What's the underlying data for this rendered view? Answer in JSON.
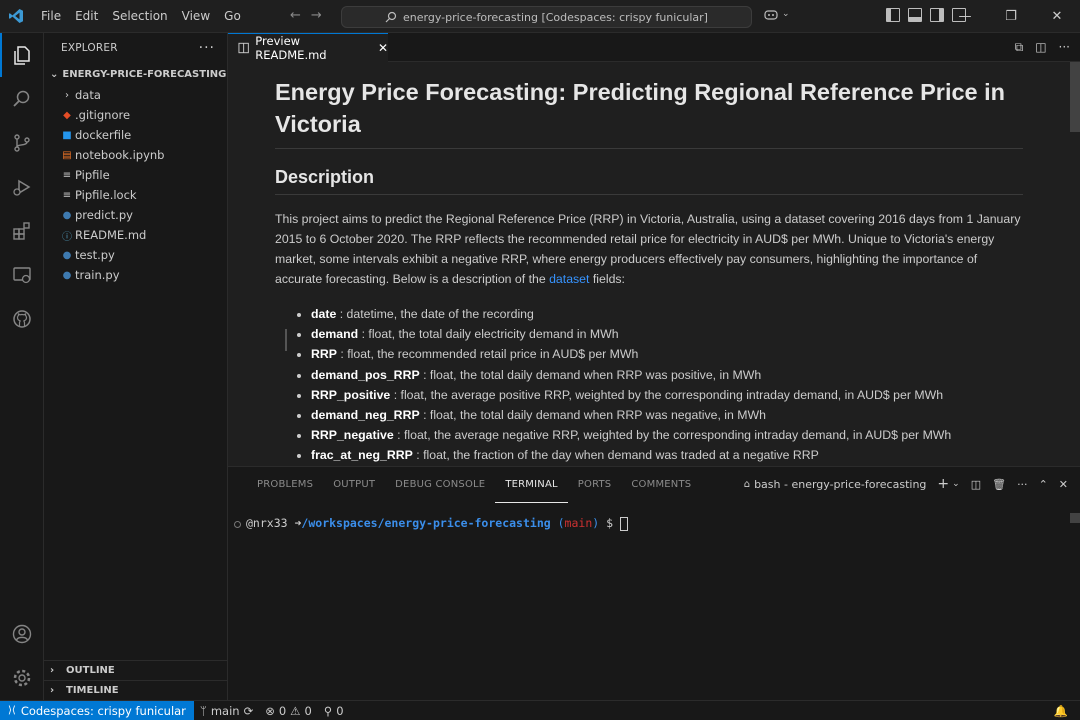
{
  "titlebar": {
    "menu": [
      "File",
      "Edit",
      "Selection",
      "View",
      "Go"
    ],
    "command_center": "energy-price-forecasting [Codespaces: crispy funicular]"
  },
  "activity_icons": [
    "explorer-icon",
    "search-icon",
    "source-control-icon",
    "run-debug-icon",
    "extensions-icon",
    "remote-explorer-icon",
    "github-icon",
    "account-icon",
    "settings-gear-icon"
  ],
  "sidebar": {
    "title": "EXPLORER",
    "root": "ENERGY-PRICE-FORECASTING [C...",
    "items": [
      {
        "label": "data",
        "kind": "folder"
      },
      {
        "label": ".gitignore",
        "kind": "gitignore"
      },
      {
        "label": "dockerfile",
        "kind": "docker"
      },
      {
        "label": "notebook.ipynb",
        "kind": "notebook"
      },
      {
        "label": "Pipfile",
        "kind": "text"
      },
      {
        "label": "Pipfile.lock",
        "kind": "text"
      },
      {
        "label": "predict.py",
        "kind": "python"
      },
      {
        "label": "README.md",
        "kind": "markdown"
      },
      {
        "label": "test.py",
        "kind": "python"
      },
      {
        "label": "train.py",
        "kind": "python"
      }
    ],
    "outline": "OUTLINE",
    "timeline": "TIMELINE"
  },
  "editor": {
    "tab_label": "Preview README.md",
    "h1": "Energy Price Forecasting: Predicting Regional Reference Price in Victoria",
    "h2": "Description",
    "para_before_link": "This project aims to predict the Regional Reference Price (RRP) in Victoria, Australia, using a dataset covering 2016 days from 1 January 2015 to 6 October 2020. The RRP reflects the recommended retail price for electricity in AUD$ per MWh. Unique to Victoria's energy market, some intervals exhibit a negative RRP, where energy producers effectively pay consumers, highlighting the importance of accurate forecasting. Below is a description of the ",
    "link": "dataset",
    "para_after_link": " fields:",
    "fields": [
      {
        "name": "date",
        "desc": " : datetime, the date of the recording"
      },
      {
        "name": "demand",
        "desc": " : float, the total daily electricity demand in MWh"
      },
      {
        "name": "RRP",
        "desc": " : float, the recommended retail price in AUD$ per MWh"
      },
      {
        "name": "demand_pos_RRP",
        "desc": " : float, the total daily demand when RRP was positive, in MWh"
      },
      {
        "name": "RRP_positive",
        "desc": " : float, the average positive RRP, weighted by the corresponding intraday demand, in AUD$ per MWh"
      },
      {
        "name": "demand_neg_RRP",
        "desc": " : float, the total daily demand when RRP was negative, in MWh"
      },
      {
        "name": "RRP_negative",
        "desc": " : float, the average negative RRP, weighted by the corresponding intraday demand, in AUD$ per MWh"
      },
      {
        "name": "frac_at_neg_RRP",
        "desc": " : float, the fraction of the day when demand was traded at a negative RRP"
      }
    ]
  },
  "panel": {
    "tabs": [
      "PROBLEMS",
      "OUTPUT",
      "DEBUG CONSOLE",
      "TERMINAL",
      "PORTS",
      "COMMENTS"
    ],
    "active_tab": "TERMINAL",
    "terminal_name": "bash - energy-price-forecasting",
    "prompt_user": "@nrx33",
    "prompt_arrow": "➜",
    "prompt_path": "/workspaces/energy-price-forecasting",
    "prompt_branch_open": "(",
    "prompt_branch": "main",
    "prompt_branch_close": ")",
    "prompt_symbol": "$"
  },
  "statusbar": {
    "remote": "Codespaces: crispy funicular",
    "branch": "main",
    "errors": "0",
    "warnings": "0",
    "ports": "0"
  },
  "colors": {
    "accent": "#0078d4",
    "link": "#3794ff",
    "terminal_path": "#3b8eea",
    "terminal_branch": "#cd3131"
  }
}
